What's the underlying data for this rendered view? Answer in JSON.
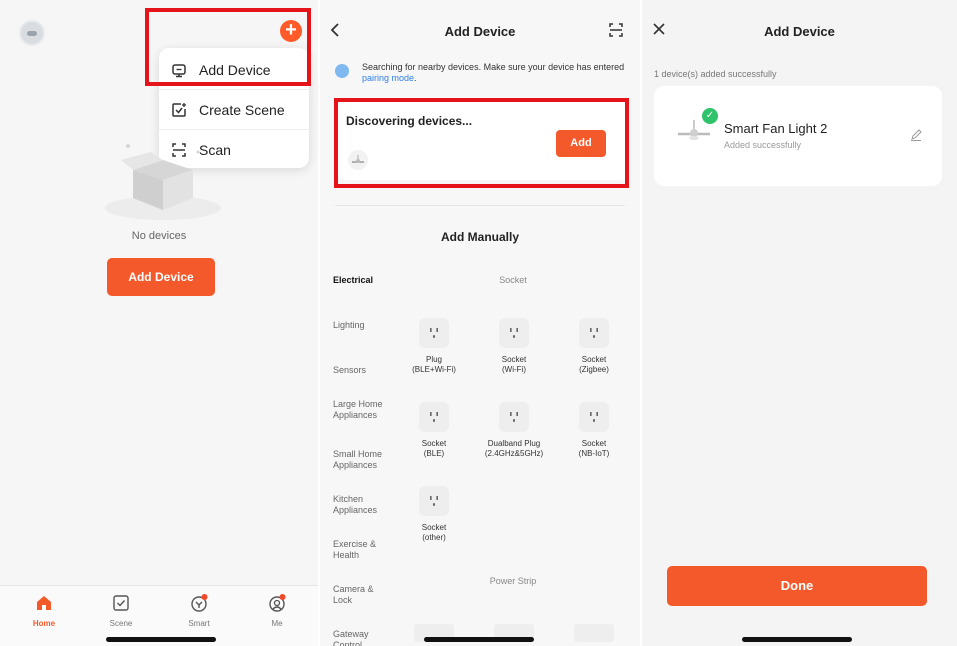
{
  "home": {
    "menu": {
      "items": [
        {
          "label": "Add Device",
          "icon": "add-device-icon"
        },
        {
          "label": "Create Scene",
          "icon": "create-scene-icon"
        },
        {
          "label": "Scan",
          "icon": "scan-icon"
        }
      ]
    },
    "empty_text": "No devices",
    "add_button": "Add Device",
    "tabs": [
      {
        "label": "Home",
        "icon": "home-icon",
        "active": true
      },
      {
        "label": "Scene",
        "icon": "scene-icon"
      },
      {
        "label": "Smart",
        "icon": "smart-icon",
        "badge": true
      },
      {
        "label": "Me",
        "icon": "me-icon",
        "badge": true
      }
    ]
  },
  "discover": {
    "title": "Add Device",
    "search_text": "Searching for nearby devices. Make sure your device has entered",
    "search_link": "pairing mode",
    "search_end": ".",
    "card_title": "Discovering devices...",
    "card_button": "Add",
    "manual_title": "Add Manually",
    "categories": [
      "Electrical",
      "Lighting",
      "Sensors",
      "Large Home Appliances",
      "Small Home Appliances",
      "Kitchen Appliances",
      "Exercise & Health",
      "Camera & Lock",
      "Gateway Control"
    ],
    "groups": [
      "Socket",
      "Power Strip"
    ],
    "devices": [
      {
        "line1": "Plug",
        "line2": "(BLE+Wi-Fi)"
      },
      {
        "line1": "Socket",
        "line2": "(Wi-Fi)"
      },
      {
        "line1": "Socket",
        "line2": "(Zigbee)"
      },
      {
        "line1": "Socket",
        "line2": "(BLE)"
      },
      {
        "line1": "Dualband Plug",
        "line2": "(2.4GHz&5GHz)"
      },
      {
        "line1": "Socket",
        "line2": "(NB-IoT)"
      },
      {
        "line1": "Socket",
        "line2": "(other)"
      }
    ]
  },
  "result": {
    "title": "Add Device",
    "count_text": "1 device(s) added successfully",
    "device_name": "Smart Fan Light 2",
    "device_status": "Added successfully",
    "done_button": "Done"
  },
  "colors": {
    "accent": "#f4592b",
    "highlight": "#e5141b",
    "success": "#2fc46b",
    "link": "#2f7fe6"
  }
}
